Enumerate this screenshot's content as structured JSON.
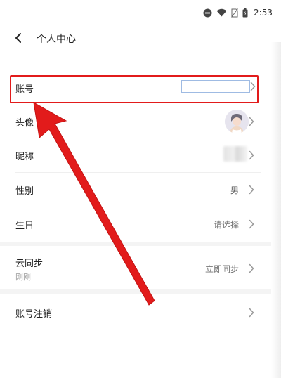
{
  "status_bar": {
    "time": "2:53"
  },
  "header": {
    "title": "个人中心"
  },
  "rows": {
    "account": {
      "label": "账号",
      "value": ""
    },
    "avatar": {
      "label": "头像"
    },
    "nickname": {
      "label": "昵称"
    },
    "gender": {
      "label": "性别",
      "value": "男"
    },
    "birthday": {
      "label": "生日",
      "value": "请选择"
    },
    "cloud_sync": {
      "label": "云同步",
      "sub": "刚刚",
      "value": "立即同步"
    },
    "delete_account": {
      "label": "账号注销"
    }
  },
  "colors": {
    "highlight": "#e21b1b",
    "chevron": "#9a9a9a",
    "input_border": "#9fbbe3"
  },
  "icons": {
    "back": "back-arrow-icon",
    "chevron": "chevron-right-icon",
    "dnd": "do-not-disturb-icon",
    "wifi": "wifi-icon",
    "sim": "no-sim-icon",
    "battery": "battery-icon"
  }
}
